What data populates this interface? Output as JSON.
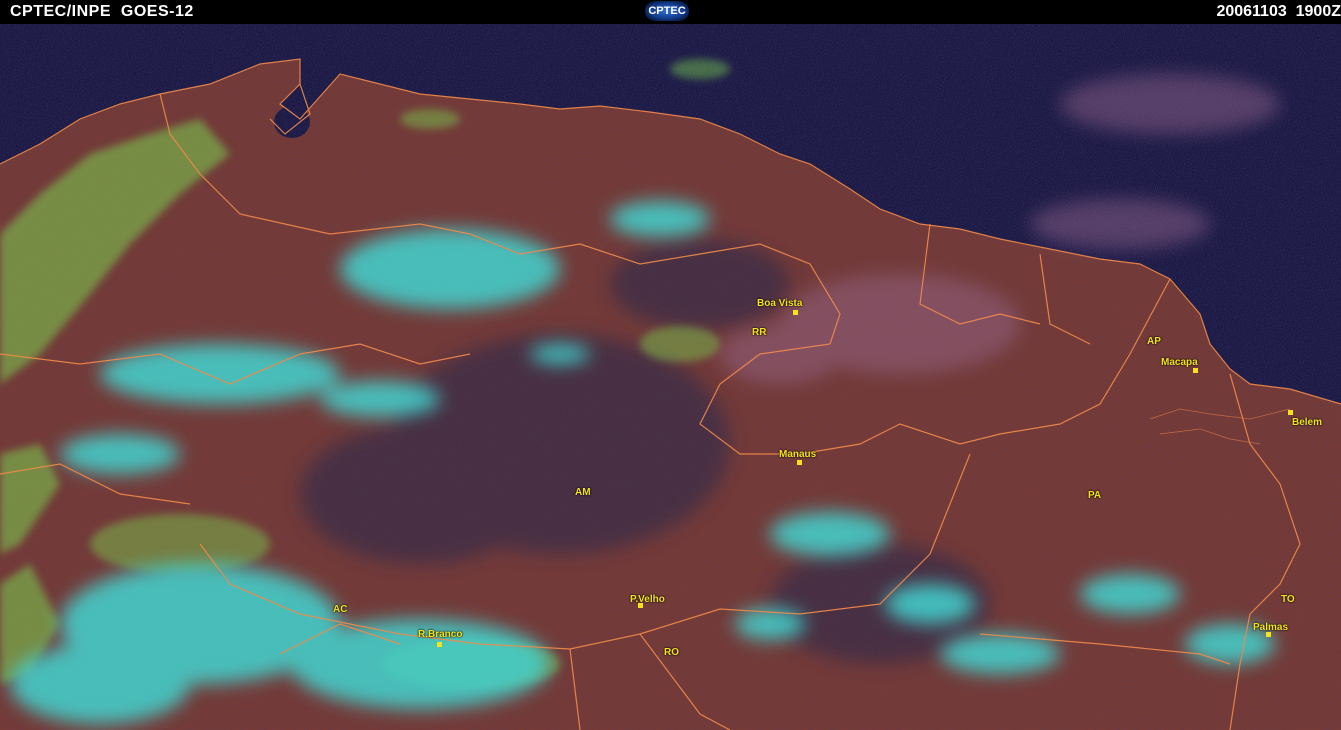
{
  "header": {
    "source": "CPTEC/INPE  GOES-12",
    "logo": "CPTEC",
    "datetime": "20061103  1900Z"
  },
  "colors": {
    "ocean": "#1c1942",
    "land": "#7a3a30",
    "cloud_high": "#43d4d0",
    "cloud_low": "#7bd04f",
    "borders": "#f28a4a",
    "labels": "#f6e31c"
  },
  "states": {
    "rr": "RR",
    "ap": "AP",
    "am": "AM",
    "pa": "PA",
    "ac": "AC",
    "ro": "RO",
    "to": "TO"
  },
  "cities": {
    "boa_vista": "Boa Vista",
    "macapa": "Macapa",
    "belem": "Belem",
    "manaus": "Manaus",
    "p_velho": "P.Velho",
    "r_branco": "R.Branco",
    "palmas": "Palmas"
  }
}
